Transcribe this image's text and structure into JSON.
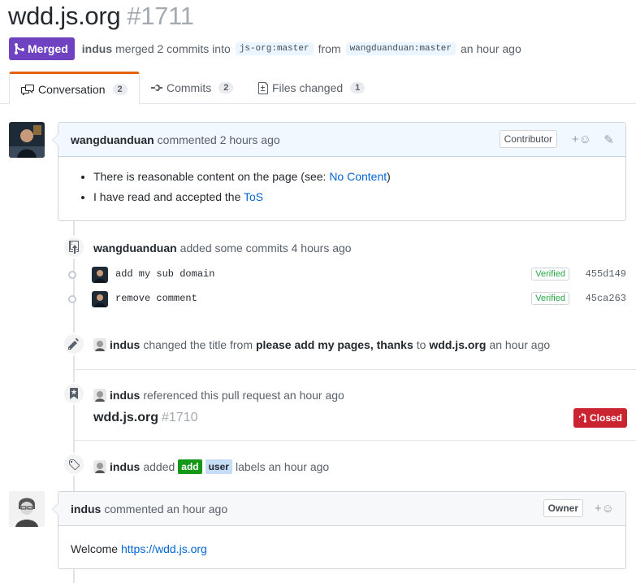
{
  "pr": {
    "title": "wdd.js.org",
    "number": "#1711",
    "status": "Merged",
    "author": "indus",
    "merge_text": "merged 2 commits into",
    "base_branch": "js-org:master",
    "from_text": "from",
    "head_branch": "wangduanduan:master",
    "time": "an hour ago"
  },
  "tabs": [
    {
      "label": "Conversation",
      "count": "2"
    },
    {
      "label": "Commits",
      "count": "2"
    },
    {
      "label": "Files changed",
      "count": "1"
    }
  ],
  "comment1": {
    "author": "wangduanduan",
    "action": "commented 2 hours ago",
    "role": "Contributor",
    "items": [
      {
        "text": "There is reasonable content on the page (see: ",
        "link": "No Content",
        "tail": ")"
      },
      {
        "text": "I have read and accepted the ",
        "link": "ToS",
        "tail": ""
      }
    ]
  },
  "commits_event": {
    "author": "wangduanduan",
    "action": "added some commits 4 hours ago",
    "commits": [
      {
        "message": "add my sub domain",
        "verified": "Verified",
        "sha": "455d149"
      },
      {
        "message": "remove comment",
        "verified": "Verified",
        "sha": "45ca263"
      }
    ]
  },
  "title_event": {
    "author": "indus",
    "action": "changed the title from",
    "old_title": "please add my pages, thanks",
    "to_text": "to",
    "new_title": "wdd.js.org",
    "time": "an hour ago"
  },
  "ref_event": {
    "author": "indus",
    "action": "referenced this pull request an hour ago",
    "ref_title": "wdd.js.org",
    "ref_number": "#1710",
    "ref_status": "Closed"
  },
  "label_event": {
    "author": "indus",
    "action": "added",
    "labels": [
      {
        "name": "add",
        "bg": "#159818",
        "fg": "#ffffff"
      },
      {
        "name": "user",
        "bg": "#c5def5",
        "fg": "#24292e"
      }
    ],
    "tail": "labels an hour ago"
  },
  "comment2": {
    "author": "indus",
    "action": "commented an hour ago",
    "role": "Owner",
    "body_text": "Welcome ",
    "body_link": "https://wdd.js.org"
  },
  "colors": {
    "merged": "#6f42c1",
    "closed": "#cb2431",
    "link": "#0366d6",
    "active_tab_accent": "#e36209"
  }
}
